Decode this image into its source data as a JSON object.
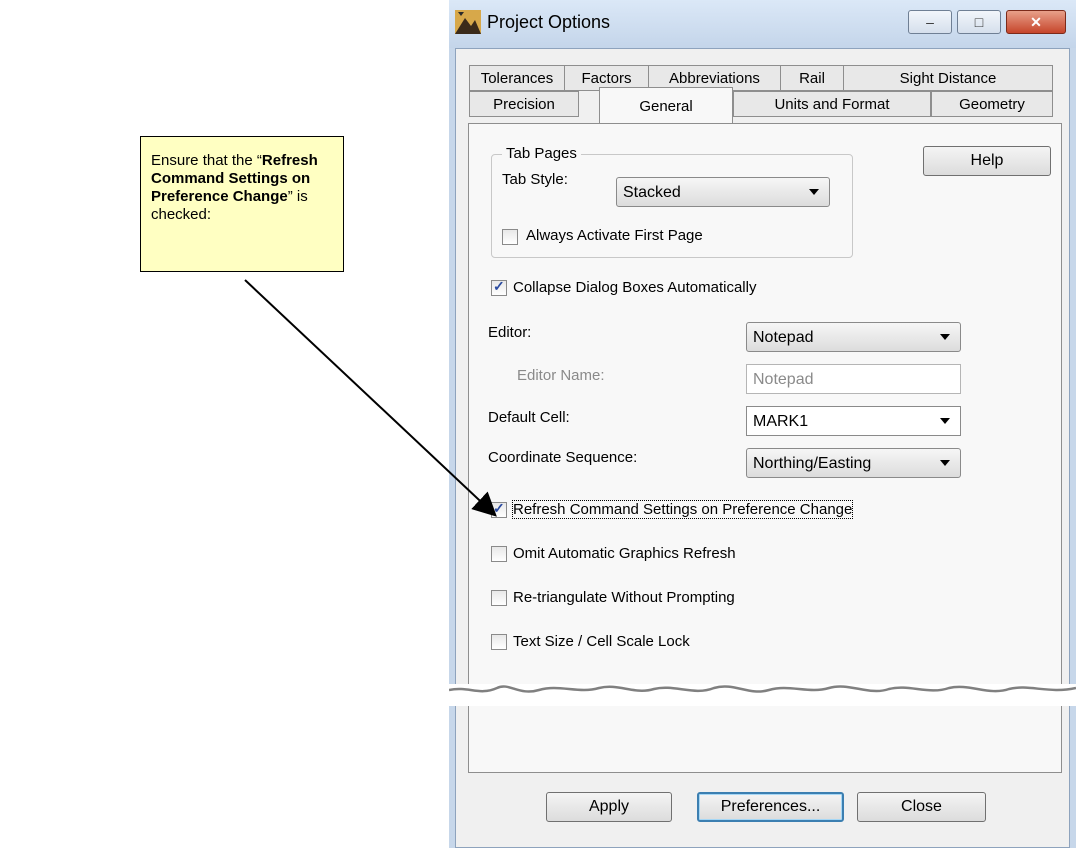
{
  "callout": {
    "before": "Ensure that the “",
    "bold": "Refresh Command Settings on Preference Change",
    "after": "” is checked:"
  },
  "window": {
    "title": "Project Options",
    "minimize_glyph": "–",
    "maximize_glyph": "□",
    "close_glyph": "✕"
  },
  "tabs": {
    "row1": [
      "Tolerances",
      "Factors",
      "Abbreviations",
      "Rail",
      "Sight Distance"
    ],
    "row2": [
      "Precision",
      "General",
      "Units and Format",
      "Geometry"
    ],
    "active": "General"
  },
  "tab_pages": {
    "group_title": "Tab Pages",
    "tab_style_label": "Tab Style:",
    "tab_style_value": "Stacked",
    "always_activate_label": "Always Activate First Page",
    "always_activate_checked": false
  },
  "help_button": "Help",
  "collapse_label": "Collapse Dialog Boxes Automatically",
  "collapse_checked": true,
  "editor": {
    "label": "Editor:",
    "value": "Notepad"
  },
  "editor_name": {
    "label": "Editor Name:",
    "value": "Notepad"
  },
  "default_cell": {
    "label": "Default Cell:",
    "value": "MARK1"
  },
  "coordinate_sequence": {
    "label": "Coordinate Sequence:",
    "value": "Northing/Easting"
  },
  "refresh_label": "Refresh Command Settings on Preference Change",
  "refresh_checked": true,
  "omit_label": "Omit Automatic Graphics Refresh",
  "omit_checked": false,
  "retriangulate_label": "Re-triangulate Without Prompting",
  "retriangulate_checked": false,
  "text_size_label": "Text Size / Cell Scale Lock",
  "text_size_checked": false,
  "buttons": {
    "apply": "Apply",
    "preferences": "Preferences...",
    "close": "Close"
  }
}
